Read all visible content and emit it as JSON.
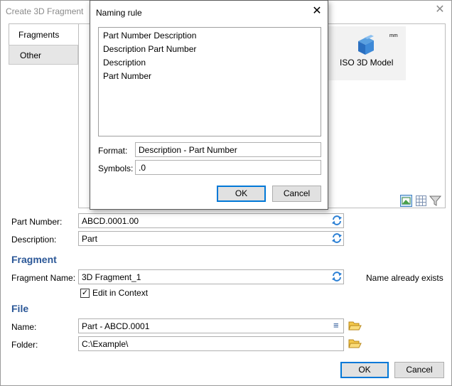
{
  "window": {
    "title": "Create 3D Fragment"
  },
  "tabs": [
    {
      "label": "Fragments"
    },
    {
      "label": "Other"
    }
  ],
  "model": {
    "label": "ISO 3D Model",
    "unit": "mm"
  },
  "part": {
    "part_number_label": "Part Number:",
    "part_number_value": "ABCD.0001.00",
    "description_label": "Description:",
    "description_value": "Part"
  },
  "fragment": {
    "section_title": "Fragment",
    "name_label": "Fragment Name:",
    "name_value": "3D Fragment_1",
    "status": "Name already exists",
    "edit_in_context_label": "Edit in Context"
  },
  "file": {
    "section_title": "File",
    "name_label": "Name:",
    "name_value": "Part - ABCD.0001",
    "folder_label": "Folder:",
    "folder_value": "C:\\Example\\"
  },
  "buttons": {
    "ok": "OK",
    "cancel": "Cancel"
  },
  "dialog": {
    "title": "Naming rule",
    "options": [
      "Part Number Description",
      "Description Part Number",
      "Description",
      "Part Number"
    ],
    "format_label": "Format:",
    "format_value": "Description - Part Number",
    "symbols_label": "Symbols:",
    "symbols_value": ".0",
    "ok": "OK",
    "cancel": "Cancel"
  },
  "colors": {
    "section": "#2b5797",
    "accent": "#0078d7",
    "refresh": "#2a7fd4",
    "folder": "#e8b530"
  }
}
